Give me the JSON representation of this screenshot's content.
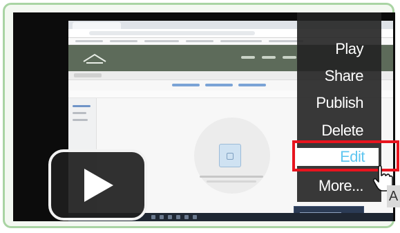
{
  "menu": {
    "items": [
      {
        "label": "Play"
      },
      {
        "label": "Share"
      },
      {
        "label": "Publish"
      },
      {
        "label": "Delete"
      },
      {
        "label": "Edit"
      },
      {
        "label": "More..."
      }
    ]
  },
  "partial_letter": "A",
  "colors": {
    "frame_border": "#a9d4a3",
    "highlight": "#e8141e",
    "edit_text": "#5fc6f0",
    "app_header": "#5d6b5a"
  },
  "icons": {
    "play": "play-icon",
    "cursor": "hand-pointer-icon",
    "folder": "folder-icon"
  }
}
